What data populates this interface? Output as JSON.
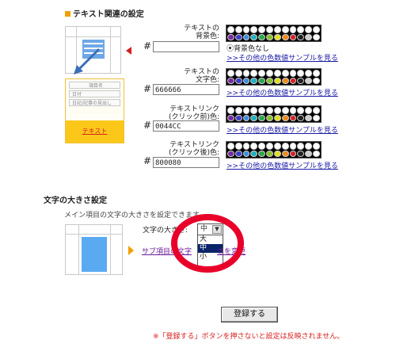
{
  "colors": {
    "accent": "#f0a000",
    "link": "#1a1aa6",
    "warning": "#d81e1e",
    "circle": "#e8002a"
  },
  "text_settings": {
    "title": "テキスト関連の設定",
    "illustration": {
      "rows": [
        "項目名",
        "日付",
        "日記/記事の見出し"
      ],
      "button_label": "テキスト"
    },
    "fields": [
      {
        "label_lines": [
          "テキストの",
          "背景色:"
        ],
        "value": "",
        "has_radio": true,
        "radio_label": "背景色なし",
        "link": ">>その他の色数値サンプルを見る"
      },
      {
        "label_lines": [
          "テキストの",
          "文字色:"
        ],
        "value": "666666",
        "has_radio": false,
        "link": ">>その他の色数値サンプルを見る"
      },
      {
        "label_lines": [
          "テキストリンク",
          "(クリック前)色:"
        ],
        "value": "0044CC",
        "has_radio": false,
        "link": ">>その他の色数値サンプルを見る"
      },
      {
        "label_lines": [
          "テキストリンク",
          "(クリック後)色:"
        ],
        "value": "800080",
        "has_radio": false,
        "link": ">>その他の色数値サンプルを見る"
      }
    ],
    "hash": "#"
  },
  "palette_colors": [
    "#ffffff",
    "#ffffff",
    "#ffffff",
    "#ffffff",
    "#ffffff",
    "#ffffff",
    "#ffffff",
    "#ffffff",
    "#ffffff",
    "#ffffff",
    "#ffffff",
    "#ffffff",
    "#7a2aa0",
    "#3d3dc8",
    "#3c8ee0",
    "#20b0c0",
    "#2aa84a",
    "#88c02a",
    "#e0e020",
    "#f08a20",
    "#d82020",
    "#202020",
    "#cfcfcf",
    "#ffffff"
  ],
  "font_size": {
    "title": "文字の大きさ設定",
    "description": "メイン項目の文字の大きさを設定できます。",
    "label": "文字の大きさ:",
    "selected": "中",
    "options": [
      "大",
      "中",
      "小"
    ],
    "link_left": "サブ項目の文字",
    "link_right": "きを変更"
  },
  "register_button": "登録する",
  "warning": "※「登録する」ボタンを押さないと設定は反映されません。"
}
